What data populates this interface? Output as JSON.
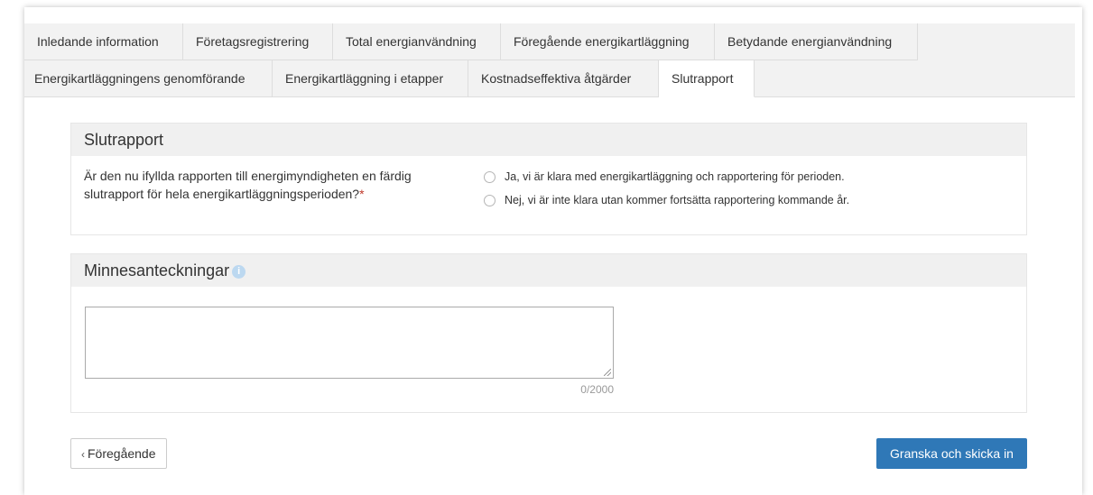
{
  "tabs_row1": [
    {
      "label": "Inledande information"
    },
    {
      "label": "Företagsregistrering"
    },
    {
      "label": "Total energianvändning"
    },
    {
      "label": "Föregående energikartläggning"
    },
    {
      "label": "Betydande energianvändning"
    }
  ],
  "tabs_row2": [
    {
      "label": "Energikartläggningens genomförande"
    },
    {
      "label": "Energikartläggning i etapper"
    },
    {
      "label": "Kostnadseffektiva åtgärder"
    },
    {
      "label": "Slutrapport",
      "active": true
    }
  ],
  "slutrapport": {
    "heading": "Slutrapport",
    "question": "Är den nu ifyllda rapporten till energimyndigheten en färdig slutrapport för hela energikartläggningsperioden?",
    "required_mark": "*",
    "options": [
      {
        "label": "Ja, vi är klara med energikartläggning och rapportering för perioden.",
        "checked": false
      },
      {
        "label": "Nej, vi är inte klara utan kommer fortsätta rapportering kommande år.",
        "checked": false
      }
    ]
  },
  "notes": {
    "heading": "Minnesanteckningar",
    "info_icon": "info-icon",
    "value": "",
    "counter": "0/2000"
  },
  "nav": {
    "prev_label": "Föregående",
    "prev_icon": "chevron-left-icon",
    "submit_label": "Granska och skicka in"
  },
  "colors": {
    "primary": "#2f78b7",
    "required": "#c0392b",
    "info": "#bcd8f0"
  }
}
